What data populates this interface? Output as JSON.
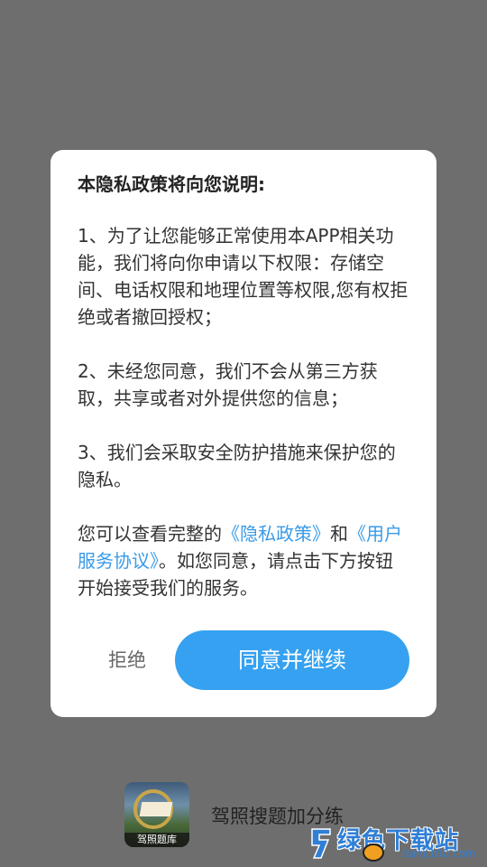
{
  "dialog": {
    "title": "本隐私政策将向您说明:",
    "paragraphs": [
      "1、为了让您能够正常使用本APP相关功能，我们将向你申请以下权限：存储空间、电话权限和地理位置等权限,您有权拒绝或者撤回授权；",
      "2、未经您同意，我们不会从第三方获取，共享或者对外提供您的信息；",
      "3、我们会采取安全防护措施来保护您的隐私。"
    ],
    "links_paragraph": {
      "prefix": "您可以查看完整的",
      "privacy_link": "《隐私政策》",
      "and": "和",
      "service_link": "《用户服务协议》",
      "suffix": "。如您同意，请点击下方按钮开始接受我们的服务。"
    },
    "reject_label": "拒绝",
    "agree_label": "同意并继续"
  },
  "app": {
    "icon_caption": "驾照题库",
    "name": "驾照搜题加分练",
    "icon_name": "app-icon"
  },
  "watermark": {
    "title": "绿色下载站",
    "domain": "danji100.com"
  },
  "colors": {
    "overlay": "#6e6e6e",
    "accent": "#35a1f0",
    "link": "#3a9be8"
  }
}
